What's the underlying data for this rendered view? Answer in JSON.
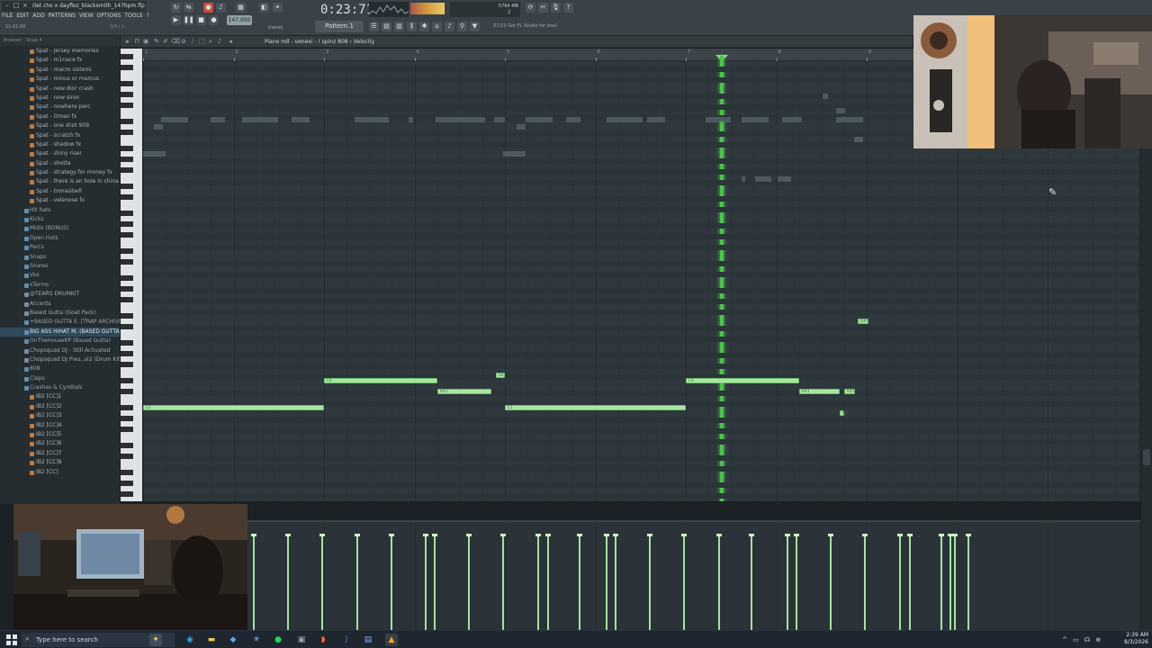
{
  "window": {
    "title": "(let cho x dayfloz_blacksmith_147bpm.flp"
  },
  "menu": [
    "FILE",
    "EDIT",
    "ADD",
    "PATTERNS",
    "VIEW",
    "OPTIONS",
    "TOOLS",
    "?"
  ],
  "hint": "11:01:00",
  "hint2": "0/4 / 1",
  "transport": {
    "tempo": "147.000",
    "time": "0:23:71",
    "pattern": "Pattern 1",
    "snap": "(none)",
    "news": "07/23  Get FL Studio for less!",
    "cpu": "5764 MB",
    "cpu_line2": "2"
  },
  "browser": {
    "header": "Browser - Snap 4",
    "items": [
      {
        "label": "Spat - jersey memories",
        "level": 2
      },
      {
        "label": "Spat - m1nace fx",
        "level": 2
      },
      {
        "label": "Spat - macro sistemi",
        "level": 2
      },
      {
        "label": "Spat - minus or marcus",
        "level": 2
      },
      {
        "label": "Spat - new dior crash",
        "level": 2
      },
      {
        "label": "Spat - new siren",
        "level": 2
      },
      {
        "label": "Spat - nowhere perc",
        "level": 2
      },
      {
        "label": "Spat - Oman fx",
        "level": 2
      },
      {
        "label": "Spat - one shot 909",
        "level": 2
      },
      {
        "label": "Spat - scratch fx",
        "level": 2
      },
      {
        "label": "Spat - shadow fx",
        "level": 2
      },
      {
        "label": "Spat - shiny riser",
        "level": 2
      },
      {
        "label": "Spat - shotta",
        "level": 2
      },
      {
        "label": "Spat - strategy for money fx",
        "level": 2
      },
      {
        "label": "Spat - there is an hole in china",
        "level": 2
      },
      {
        "label": "Spat - tomasibell",
        "level": 2
      },
      {
        "label": "Spat - velenose fx",
        "level": 2
      },
      {
        "label": "Hit hats",
        "level": 1
      },
      {
        "label": "Kicks",
        "level": 1
      },
      {
        "label": "Midis (BONUS)",
        "level": 1
      },
      {
        "label": "Open Hats",
        "level": 1
      },
      {
        "label": "Percs",
        "level": 1
      },
      {
        "label": "Snaps",
        "level": 1
      },
      {
        "label": "Snares",
        "level": 1
      },
      {
        "label": "Vox",
        "level": 1
      },
      {
        "label": "xTerms",
        "level": 1
      },
      {
        "label": "@TEARS DRUMKIT",
        "level": 0
      },
      {
        "label": "Accents",
        "level": 0
      },
      {
        "label": "Based Gutta (Goat Pack)",
        "level": 0
      },
      {
        "label": "+BASED GUTTA E. [TRAP ARCHIVE]",
        "level": 1
      },
      {
        "label": "BIG ASS HIHAT M. (BASED GUTTA)",
        "level": 1
      },
      {
        "label": "OnTheHouseKP (Based Gutta)",
        "level": 1
      },
      {
        "label": "Chopsquad DJ - Still Activated",
        "level": 0
      },
      {
        "label": "Chopsquad DJ Pres..ol2 (Drum Kit)",
        "level": 0
      },
      {
        "label": "808",
        "level": 1
      },
      {
        "label": "Claps",
        "level": 1
      },
      {
        "label": "Crashes & Cymbals",
        "level": 1
      },
      {
        "label": "IB2 [CC]1",
        "level": 2
      },
      {
        "label": "IB2 [CC]2",
        "level": 2
      },
      {
        "label": "IB2 [CC]3",
        "level": 2
      },
      {
        "label": "IB2 [CC]4",
        "level": 2
      },
      {
        "label": "IB2 [CC]5",
        "level": 2
      },
      {
        "label": "IB2 [CC]6",
        "level": 2
      },
      {
        "label": "IB2 [CC]7",
        "level": 2
      },
      {
        "label": "IB2 [CC]8",
        "level": 2
      },
      {
        "label": "IB2 [CC]",
        "level": 2
      }
    ]
  },
  "pianoroll": {
    "label": "Piano roll - venexi - ! spinz 808 › Velocity",
    "ruler": [
      "1",
      "2",
      "3",
      "4",
      "5",
      "6",
      "7",
      "8",
      "9"
    ],
    "notes": [
      {
        "pitch": "C3",
        "start": 1.0,
        "len": 2.0,
        "row": 64
      },
      {
        "pitch": "C4",
        "start": 3.0,
        "len": 1.25,
        "row": 59
      },
      {
        "pitch": "A#3",
        "start": 4.25,
        "len": 0.6,
        "row": 61
      },
      {
        "pitch": "D4",
        "start": 4.9,
        "len": 0.1,
        "row": 58
      },
      {
        "pitch": "C3",
        "start": 5.0,
        "len": 2.0,
        "row": 64
      },
      {
        "pitch": "C4",
        "start": 7.0,
        "len": 1.25,
        "row": 59
      },
      {
        "pitch": "A#3",
        "start": 8.25,
        "len": 0.45,
        "row": 61
      },
      {
        "pitch": "A#3",
        "start": 8.75,
        "len": 0.12,
        "row": 61
      },
      {
        "pitch": "B2",
        "start": 8.7,
        "len": 0.05,
        "row": 65
      },
      {
        "pitch": "D#4",
        "start": 8.9,
        "len": 0.12,
        "row": 48
      }
    ],
    "playhead_beat": 7.4
  },
  "velocity": {
    "bars": [
      0.95,
      0.95,
      0.95,
      0.95,
      0.95,
      0.95,
      0.95,
      0.95,
      0.95,
      0.95,
      0.95,
      0.95,
      0.95,
      0.95,
      0.95,
      0.95,
      0.95,
      0.95,
      0.95,
      0.95,
      0.95,
      0.95,
      0.95,
      0.95,
      0.95,
      0.95,
      0.95,
      0.95
    ]
  },
  "taskbar": {
    "search_placeholder": "Type here to search",
    "time": "2:39 AM",
    "date": "8/3/2026"
  },
  "colors": {
    "note": "#a9e5a0",
    "playhead": "#4ec24d",
    "bg": "#2f383d"
  }
}
